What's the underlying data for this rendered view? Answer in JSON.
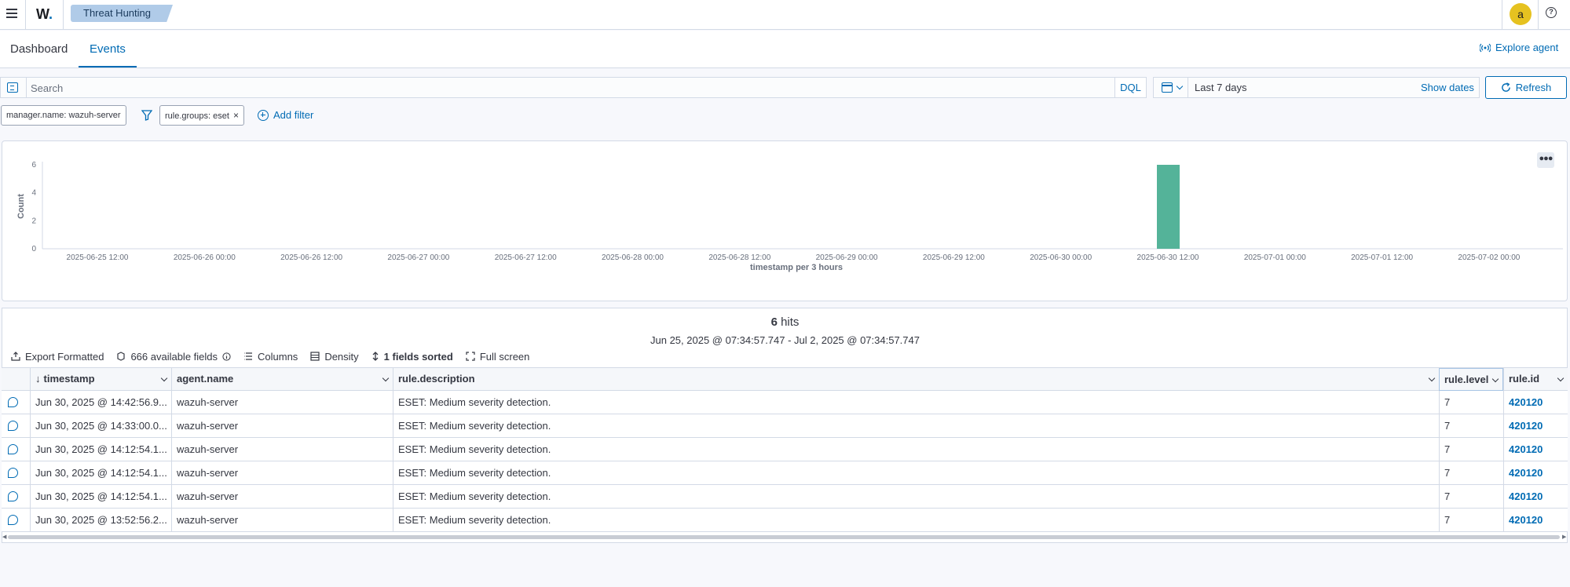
{
  "header": {
    "logo": "W",
    "logo_dot": ".",
    "breadcrumb": "Threat Hunting",
    "avatar_initial": "a",
    "help_glyph": "?"
  },
  "tabs": [
    {
      "label": "Dashboard",
      "active": false
    },
    {
      "label": "Events",
      "active": true
    }
  ],
  "explore_agent": "Explore agent",
  "query": {
    "placeholder": "Search",
    "language": "DQL",
    "date_range": "Last 7 days",
    "show_dates": "Show dates",
    "refresh": "Refresh"
  },
  "filters": [
    {
      "label": "manager.name: wazuh-server",
      "removable": false
    },
    {
      "label": "rule.groups: eset",
      "removable": true
    }
  ],
  "add_filter": "Add filter",
  "chart_data": {
    "type": "bar",
    "xlabel": "timestamp per 3 hours",
    "ylabel": "Count",
    "ylim": [
      0,
      6
    ],
    "yticks": [
      0,
      2,
      4,
      6
    ],
    "x_ticks": [
      "2025-06-25 12:00",
      "2025-06-26 00:00",
      "2025-06-26 12:00",
      "2025-06-27 00:00",
      "2025-06-27 12:00",
      "2025-06-28 00:00",
      "2025-06-28 12:00",
      "2025-06-29 00:00",
      "2025-06-29 12:00",
      "2025-06-30 00:00",
      "2025-06-30 12:00",
      "2025-07-01 00:00",
      "2025-07-01 12:00",
      "2025-07-02 00:00"
    ],
    "bars": [
      {
        "x": "2025-06-30 12:00",
        "value": 6
      }
    ],
    "bar_color": "#54b399",
    "grid": false
  },
  "results": {
    "hits_count": "6",
    "hits_label": "hits",
    "range": "Jun 25, 2025 @ 07:34:57.747 - Jul 2, 2025 @ 07:34:57.747"
  },
  "toolbar": {
    "export": "Export Formatted",
    "fields": "666 available fields",
    "columns": "Columns",
    "density": "Density",
    "sorted": "1 fields sorted",
    "fullscreen": "Full screen"
  },
  "table": {
    "columns": [
      "timestamp",
      "agent.name",
      "rule.description",
      "rule.level",
      "rule.id"
    ],
    "rows": [
      [
        "Jun 30, 2025 @ 14:42:56.9...",
        "wazuh-server",
        "ESET: Medium severity detection.",
        "7",
        "420120"
      ],
      [
        "Jun 30, 2025 @ 14:33:00.0...",
        "wazuh-server",
        "ESET: Medium severity detection.",
        "7",
        "420120"
      ],
      [
        "Jun 30, 2025 @ 14:12:54.1...",
        "wazuh-server",
        "ESET: Medium severity detection.",
        "7",
        "420120"
      ],
      [
        "Jun 30, 2025 @ 14:12:54.1...",
        "wazuh-server",
        "ESET: Medium severity detection.",
        "7",
        "420120"
      ],
      [
        "Jun 30, 2025 @ 14:12:54.1...",
        "wazuh-server",
        "ESET: Medium severity detection.",
        "7",
        "420120"
      ],
      [
        "Jun 30, 2025 @ 13:52:56.2...",
        "wazuh-server",
        "ESET: Medium severity detection.",
        "7",
        "420120"
      ]
    ]
  },
  "colors": {
    "accent": "#006bb4",
    "avatar": "#e6c220",
    "breadcrumb": "#b0cbe8"
  }
}
